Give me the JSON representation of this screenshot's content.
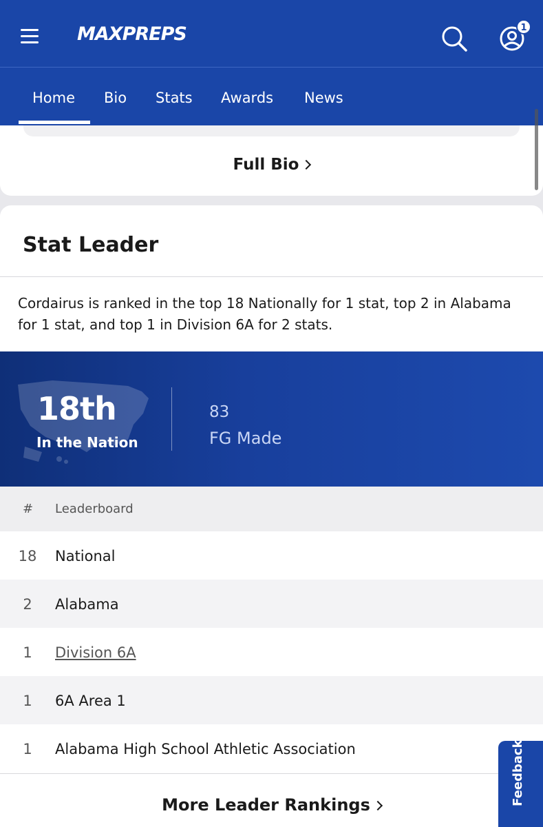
{
  "header": {
    "logo_text": "MAXPREPS",
    "notification_count": "1"
  },
  "tabs": [
    {
      "label": "Home",
      "active": true
    },
    {
      "label": "Bio"
    },
    {
      "label": "Stats"
    },
    {
      "label": "Awards"
    },
    {
      "label": "News"
    }
  ],
  "bio": {
    "full_bio_link": "Full Bio"
  },
  "stat_leader": {
    "title": "Stat Leader",
    "description": "Cordairus is ranked in the top 18 Nationally for 1 stat, top 2 in Alabama for 1 stat, and top 1 in Division 6A for 2 stats.",
    "banner": {
      "rank": "18th",
      "rank_label": "In the Nation",
      "stat_value": "83",
      "stat_name": "FG Made"
    },
    "leaderboard_headers": {
      "rank": "#",
      "name": "Leaderboard"
    },
    "leaderboard": [
      {
        "rank": "18",
        "name": "National"
      },
      {
        "rank": "2",
        "name": "Alabama"
      },
      {
        "rank": "1",
        "name": "Division 6A",
        "link": true
      },
      {
        "rank": "1",
        "name": "6A Area 1"
      },
      {
        "rank": "1",
        "name": "Alabama High School Athletic Association"
      }
    ],
    "more_link": "More Leader Rankings"
  },
  "feedback_label": "Feedback",
  "colors": {
    "brand_blue": "#1a46a8",
    "banner_dark": "#0f2f78"
  }
}
